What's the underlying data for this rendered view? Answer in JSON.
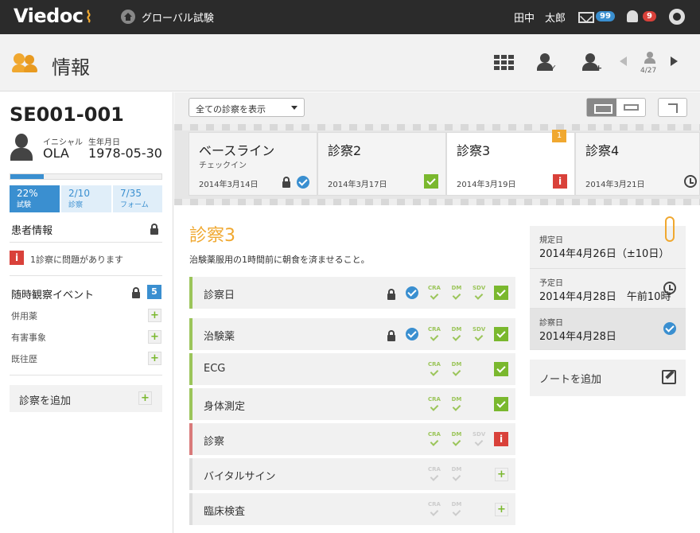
{
  "topbar": {
    "logo": "Viedoc",
    "study_name": "グローバル試験",
    "user_name": "田中　太郎",
    "mail_count": "99",
    "alert_count": "9"
  },
  "header": {
    "title": "情報",
    "nav_position": "4/27"
  },
  "subject": {
    "id": "SE001-001",
    "initials_label": "イニシャル",
    "initials": "OLA",
    "dob_label": "生年月日",
    "dob": "1978-05-30",
    "progress": 0.22,
    "stats": [
      {
        "value": "22%",
        "label": "試験"
      },
      {
        "value": "2/10",
        "label": "診察"
      },
      {
        "value": "7/35",
        "label": "フォーム"
      }
    ]
  },
  "sidebar": {
    "patient_info": "患者情報",
    "issue_text": "1診察に問題があります",
    "events_title": "随時観察イベント",
    "events_count": "5",
    "events": [
      "併用薬",
      "有害事象",
      "既往歴"
    ],
    "add_visit": "診察を追加"
  },
  "toolbar": {
    "filter_value": "全ての診察を表示"
  },
  "visits": [
    {
      "title": "ベースライン",
      "subtitle": "チェックイン",
      "date": "2014年3月14日"
    },
    {
      "title": "診察2",
      "date": "2014年3月17日"
    },
    {
      "title": "診察3",
      "date": "2014年3月19日",
      "badge": "1"
    },
    {
      "title": "診察4",
      "date": "2014年3月21日"
    }
  ],
  "visit": {
    "title": "診察3",
    "description": "治験薬服用の1時間前に朝食を済ませること。",
    "forms": [
      {
        "label": "診察日"
      },
      {
        "label": "治験薬"
      },
      {
        "label": "ECG"
      },
      {
        "label": "身体測定"
      },
      {
        "label": "診察"
      },
      {
        "label": "バイタルサイン"
      },
      {
        "label": "臨床検査"
      }
    ],
    "tags": {
      "cra": "CRA",
      "dm": "DM",
      "sdv": "SDV"
    }
  },
  "dates": {
    "planned_label": "規定日",
    "planned": "2014年4月26日（±10日）",
    "scheduled_label": "予定日",
    "scheduled": "2014年4月28日　午前10時",
    "visit_label": "診察日",
    "visit": "2014年4月28日"
  },
  "notes": {
    "add_note": "ノートを追加"
  }
}
